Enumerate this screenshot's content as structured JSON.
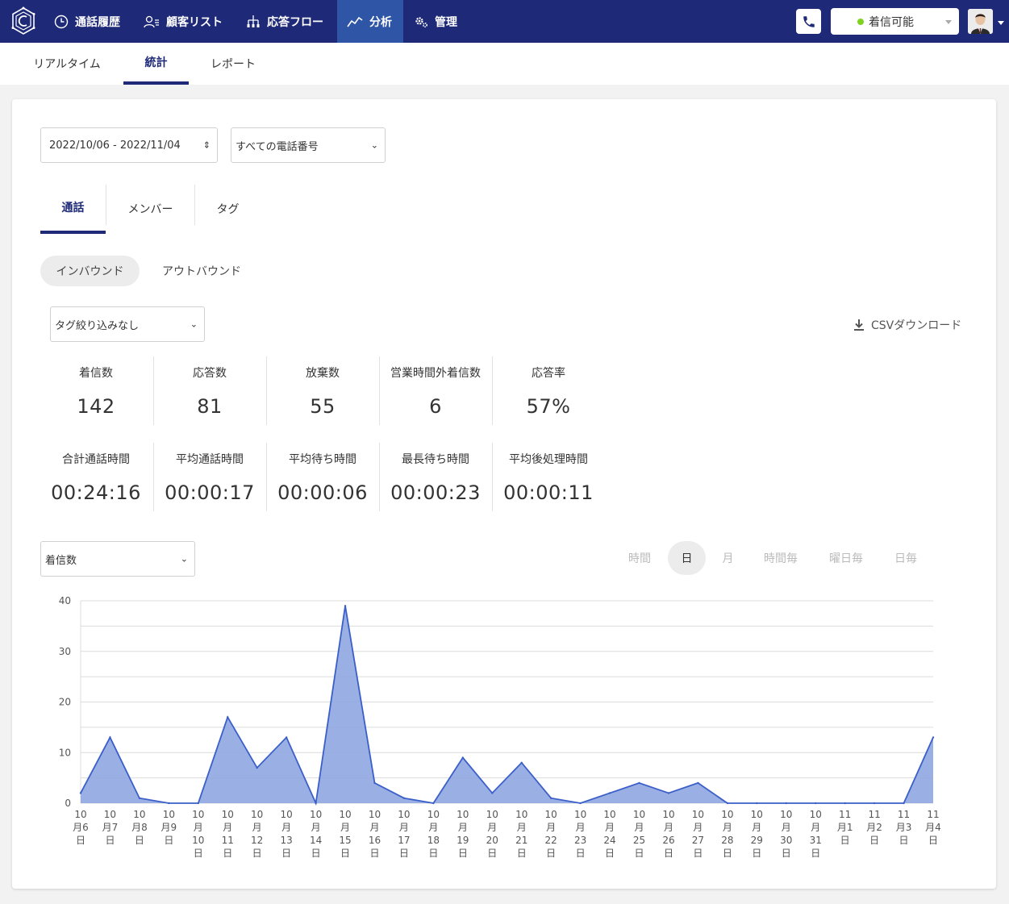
{
  "nav": {
    "items": [
      {
        "label": "通話履歴",
        "icon": "clock-icon"
      },
      {
        "label": "顧客リスト",
        "icon": "customer-list-icon"
      },
      {
        "label": "応答フロー",
        "icon": "flow-icon"
      },
      {
        "label": "分析",
        "icon": "chart-line-icon"
      },
      {
        "label": "管理",
        "icon": "gear-icon"
      }
    ],
    "status_label": "着信可能"
  },
  "subtabs": [
    "リアルタイム",
    "統計",
    "レポート"
  ],
  "filters": {
    "date_range": "2022/10/06 - 2022/11/04",
    "phone_number": "すべての電話番号",
    "tag_filter": "タグ絞り込みなし",
    "metric": "着信数"
  },
  "tabs": [
    "通話",
    "メンバー",
    "タグ"
  ],
  "pills": [
    "インバウンド",
    "アウトバウンド"
  ],
  "csv_label": "CSVダウンロード",
  "stats_row1": [
    {
      "label": "着信数",
      "value": "142"
    },
    {
      "label": "応答数",
      "value": "81"
    },
    {
      "label": "放棄数",
      "value": "55"
    },
    {
      "label": "営業時間外着信数",
      "value": "6"
    },
    {
      "label": "応答率",
      "value": "57%"
    }
  ],
  "stats_row2": [
    {
      "label": "合計通話時間",
      "value": "00:24:16"
    },
    {
      "label": "平均通話時間",
      "value": "00:00:17"
    },
    {
      "label": "平均待ち時間",
      "value": "00:00:06"
    },
    {
      "label": "最長待ち時間",
      "value": "00:00:23"
    },
    {
      "label": "平均後処理時間",
      "value": "00:00:11"
    }
  ],
  "granularity": [
    "時間",
    "日",
    "月",
    "時間毎",
    "曜日毎",
    "日毎"
  ],
  "colors": {
    "nav_bg": "#1e2a78",
    "nav_active": "#2f56a6",
    "area_fill": "#8fa6e0",
    "area_line": "#3b5fc9",
    "status_green": "#7ed321"
  },
  "chart_data": {
    "type": "area",
    "x_label_lines": [
      [
        "10",
        "月6",
        "日"
      ],
      [
        "10",
        "月7",
        "日"
      ],
      [
        "10",
        "月8",
        "日"
      ],
      [
        "10",
        "月9",
        "日"
      ],
      [
        "10",
        "月",
        "10",
        "日"
      ],
      [
        "10",
        "月",
        "11",
        "日"
      ],
      [
        "10",
        "月",
        "12",
        "日"
      ],
      [
        "10",
        "月",
        "13",
        "日"
      ],
      [
        "10",
        "月",
        "14",
        "日"
      ],
      [
        "10",
        "月",
        "15",
        "日"
      ],
      [
        "10",
        "月",
        "16",
        "日"
      ],
      [
        "10",
        "月",
        "17",
        "日"
      ],
      [
        "10",
        "月",
        "18",
        "日"
      ],
      [
        "10",
        "月",
        "19",
        "日"
      ],
      [
        "10",
        "月",
        "20",
        "日"
      ],
      [
        "10",
        "月",
        "21",
        "日"
      ],
      [
        "10",
        "月",
        "22",
        "日"
      ],
      [
        "10",
        "月",
        "23",
        "日"
      ],
      [
        "10",
        "月",
        "24",
        "日"
      ],
      [
        "10",
        "月",
        "25",
        "日"
      ],
      [
        "10",
        "月",
        "26",
        "日"
      ],
      [
        "10",
        "月",
        "27",
        "日"
      ],
      [
        "10",
        "月",
        "28",
        "日"
      ],
      [
        "10",
        "月",
        "29",
        "日"
      ],
      [
        "10",
        "月",
        "30",
        "日"
      ],
      [
        "10",
        "月",
        "31",
        "日"
      ],
      [
        "11",
        "月1",
        "日"
      ],
      [
        "11",
        "月2",
        "日"
      ],
      [
        "11",
        "月3",
        "日"
      ],
      [
        "11",
        "月4",
        "日"
      ]
    ],
    "values": [
      2,
      13,
      1,
      0,
      0,
      17,
      7,
      13,
      0,
      39,
      4,
      1,
      0,
      9,
      2,
      8,
      1,
      0,
      2,
      4,
      2,
      4,
      0,
      0,
      0,
      0,
      0,
      0,
      0,
      13
    ],
    "ylim": [
      0,
      40
    ],
    "yticks": [
      0,
      10,
      20,
      30,
      40
    ],
    "grid": true,
    "legend": "none"
  }
}
